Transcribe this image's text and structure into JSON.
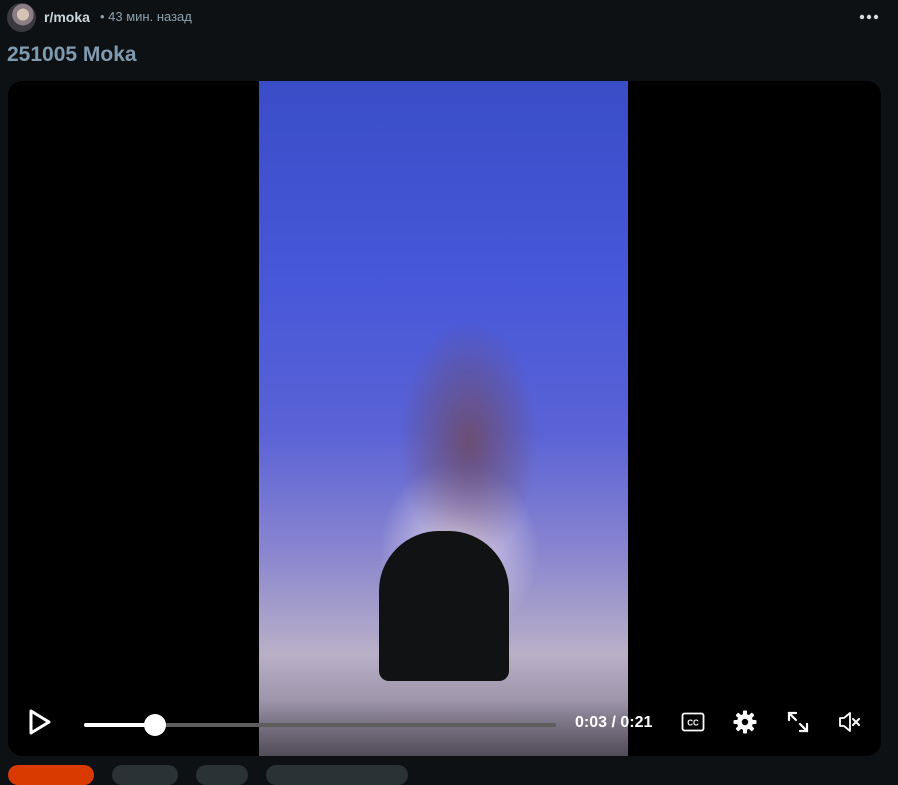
{
  "post": {
    "subreddit": "r/moka",
    "meta": "• 43 мин. назад",
    "title": "251005 Moka"
  },
  "video": {
    "current_time": "0:03",
    "duration": "0:21",
    "time_display": "0:03 / 0:21",
    "progress_fraction": 0.15,
    "muted": true
  },
  "icons": [
    "avatar",
    "more-options-icon",
    "play-icon",
    "closed-captions-icon",
    "settings-gear-icon",
    "fullscreen-icon",
    "muted-speaker-icon"
  ],
  "colors": {
    "background": "#0e1113",
    "title": "#7f9bb0",
    "upvote_accent": "#d93a00"
  }
}
